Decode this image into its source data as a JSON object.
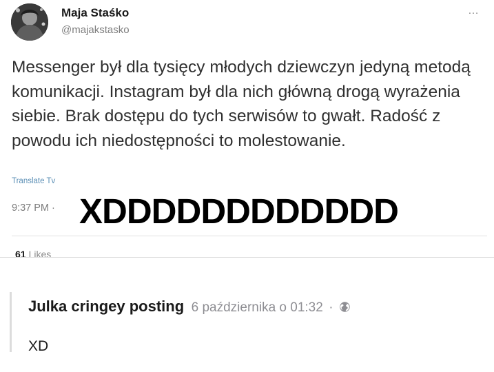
{
  "tweet": {
    "author_name": "Maja Staśko",
    "author_handle": "@majakstasko",
    "more_icon": "…",
    "text": "Messenger był dla tysięcy młodych dziewczyn jedyną metodą komunikacji. Instagram był dla nich główną drogą wyrażenia siebie. Brak dostępu do tych serwisów to gwałt. Radość z powodu ich niedostępności to molestowanie.",
    "translate_label": "Translate Tv",
    "time": "9:37 PM ·",
    "overlay_text": "XDDDDDDDDDDDD",
    "likes_count": "61",
    "likes_label": "Likes"
  },
  "comment": {
    "author": "Julka cringey posting",
    "date": "6 października o 01:32",
    "separator": "·",
    "privacy_icon": "globe-icon",
    "text": "XD"
  },
  "colors": {
    "handle_gray": "#7d7d7d",
    "tweet_text": "#303030",
    "translate_blue": "#5b8fb5",
    "comment_meta_gray": "#8e8e93"
  }
}
